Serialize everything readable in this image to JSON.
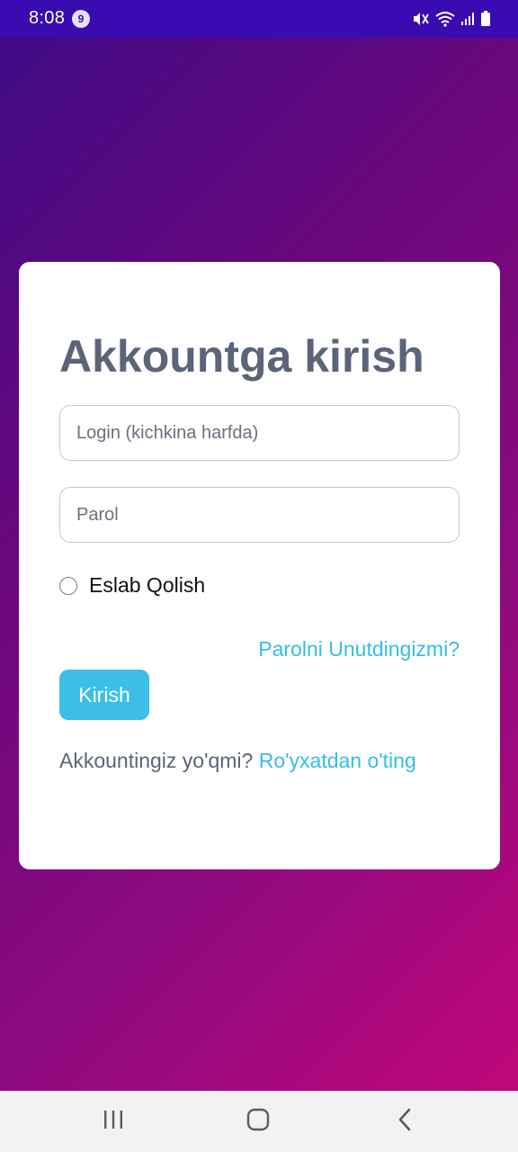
{
  "status_bar": {
    "time": "8:08",
    "notification_count": "9",
    "icons": [
      "mute-icon",
      "wifi-icon",
      "signal-icon",
      "battery-icon"
    ]
  },
  "login_card": {
    "title": "Akkountga kirish",
    "login_placeholder": "Login (kichkina harfda)",
    "login_value": "",
    "password_placeholder": "Parol",
    "password_value": "",
    "remember_label": "Eslab Qolish",
    "remember_checked": false,
    "forgot_link": "Parolni Unutdingizmi?",
    "submit_label": "Kirish",
    "signup_prompt": "Akkountingiz yo'qmi?",
    "signup_link": "Ro'yxatdan o'ting"
  },
  "nav_bar": {
    "buttons": [
      "recent-apps-icon",
      "home-icon",
      "back-icon"
    ]
  },
  "colors": {
    "status_bar_bg": "#3a0bb0",
    "gradient_start": "#3d0b86",
    "gradient_end": "#c4077a",
    "title_color": "#5b6479",
    "accent": "#3bbfe8"
  }
}
